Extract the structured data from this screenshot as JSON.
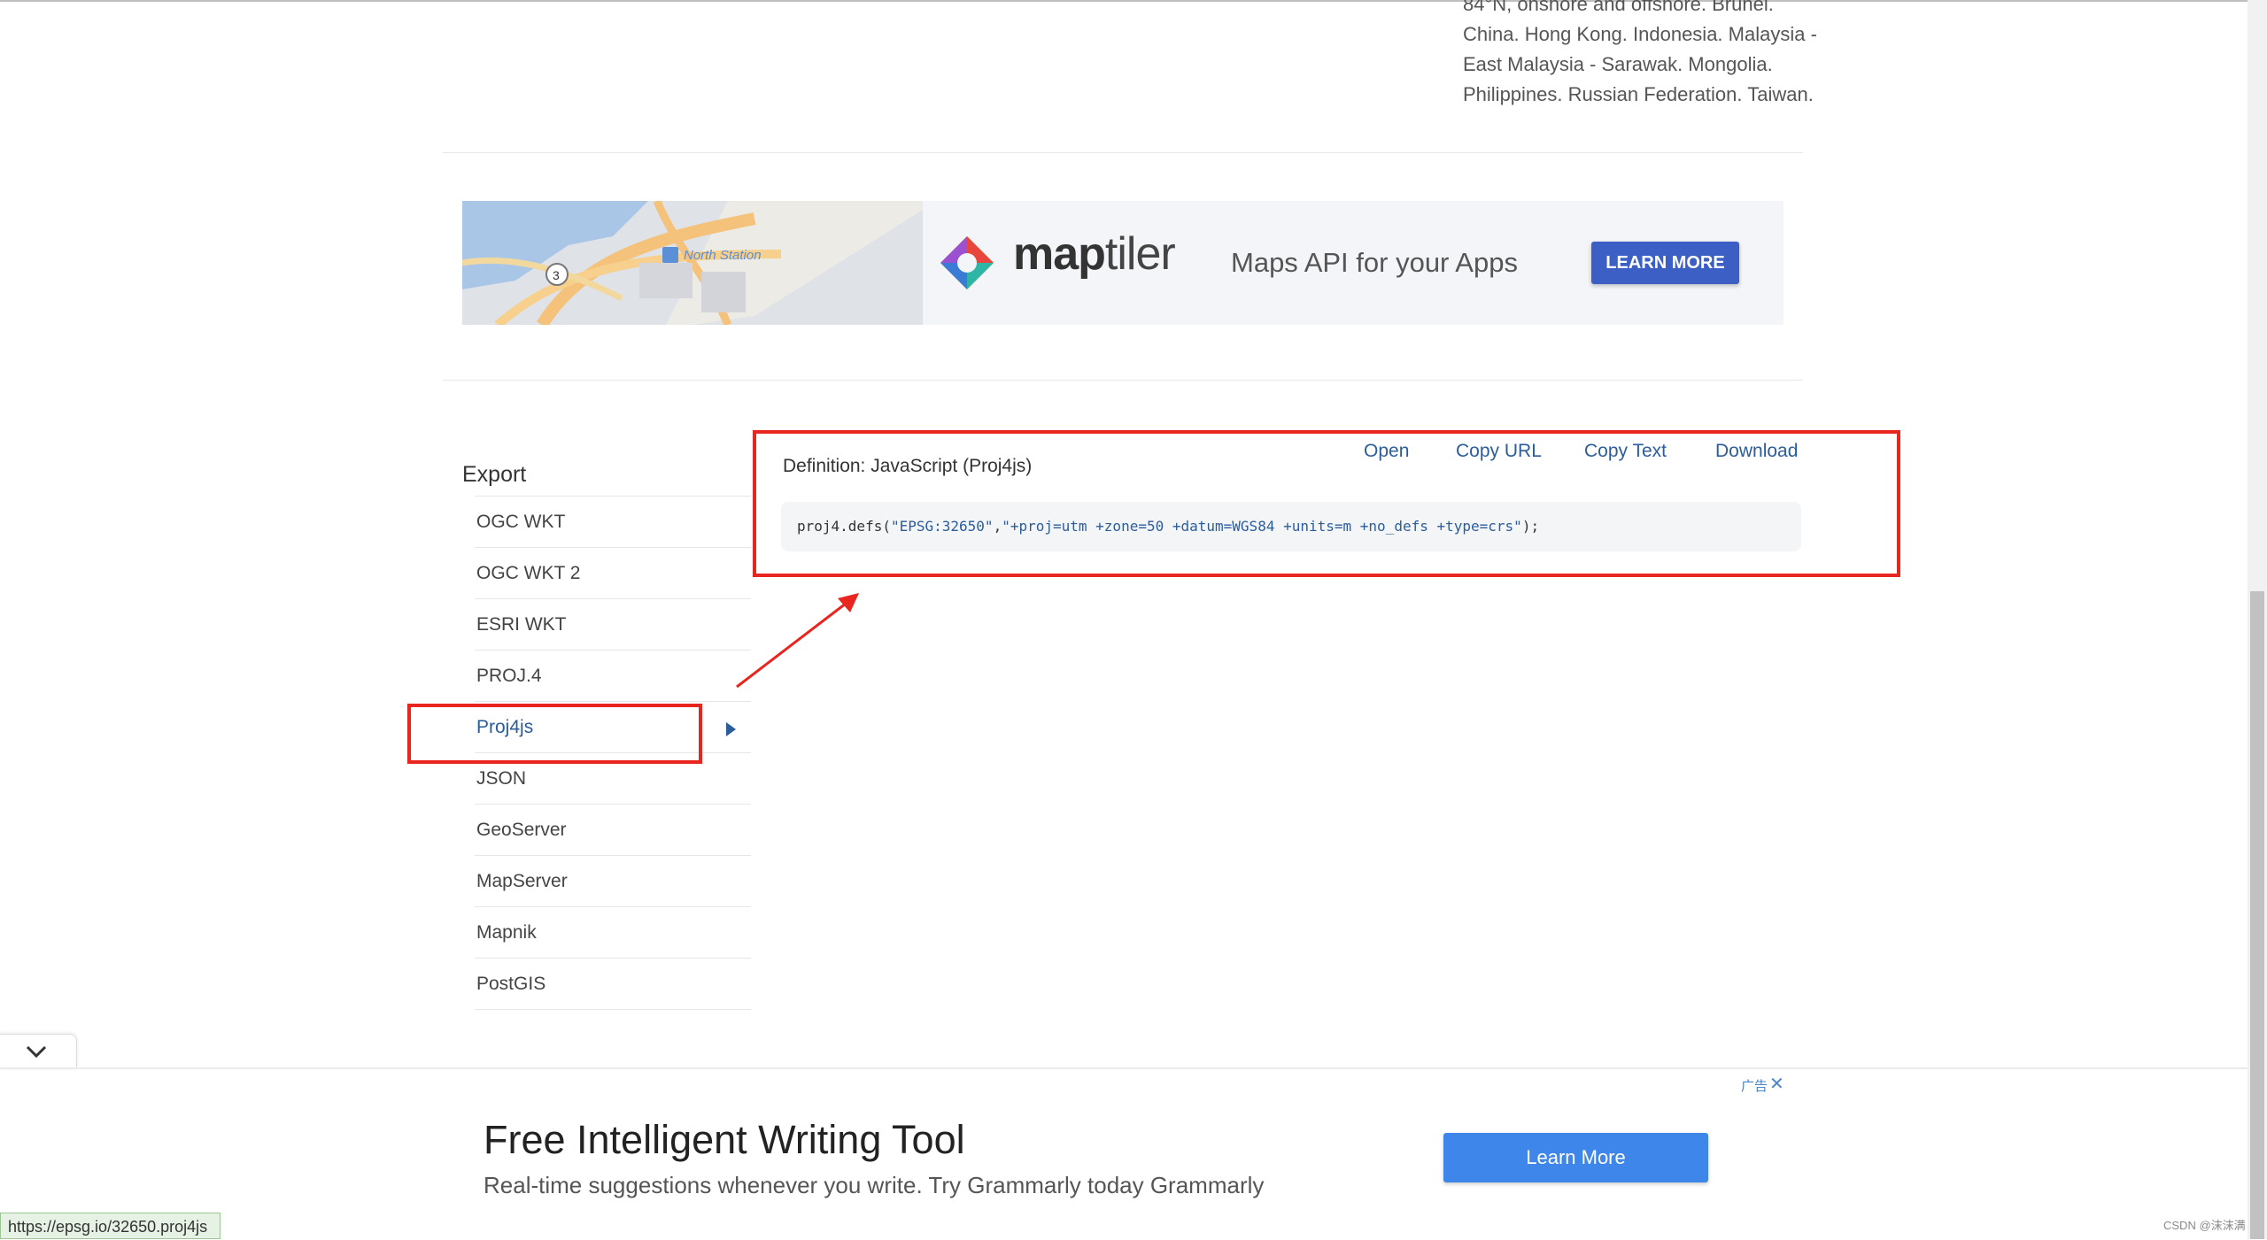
{
  "top_text": "84°N, onshore and offshore. Brunei. China. Hong Kong. Indonesia. Malaysia - East Malaysia - Sarawak. Mongolia. Philippines. Russian Federation. Taiwan.",
  "banner": {
    "map_station": "North Station",
    "map_marker": "3",
    "brand_bold": "map",
    "brand_light": "tiler",
    "tagline": "Maps API for your Apps",
    "cta": "LEARN MORE"
  },
  "export": {
    "title": "Export",
    "items": [
      {
        "label": "OGC WKT"
      },
      {
        "label": "OGC WKT 2"
      },
      {
        "label": "ESRI WKT"
      },
      {
        "label": "PROJ.4"
      },
      {
        "label": "Proj4js"
      },
      {
        "label": "JSON"
      },
      {
        "label": "GeoServer"
      },
      {
        "label": "MapServer"
      },
      {
        "label": "Mapnik"
      },
      {
        "label": "PostGIS"
      }
    ],
    "active": "Proj4js"
  },
  "definition": {
    "label": "Definition: JavaScript (Proj4js)",
    "actions": {
      "open": "Open",
      "copy_url": "Copy URL",
      "copy_text": "Copy Text",
      "download": "Download"
    },
    "code_prefix": "proj4.defs(",
    "code_arg1": "\"EPSG:32650\"",
    "code_comma": ",",
    "code_arg2": "\"+proj=utm +zone=50 +datum=WGS84 +units=m +no_defs +type=crs\"",
    "code_suffix": ");"
  },
  "ad": {
    "label": "广告",
    "close": "✕",
    "title": "Free Intelligent Writing Tool",
    "subtitle": "Real-time suggestions whenever you write. Try Grammarly today Grammarly",
    "cta": "Learn More"
  },
  "status_url": "https://epsg.io/32650.proj4js",
  "watermark": "CSDN @沫沫满"
}
